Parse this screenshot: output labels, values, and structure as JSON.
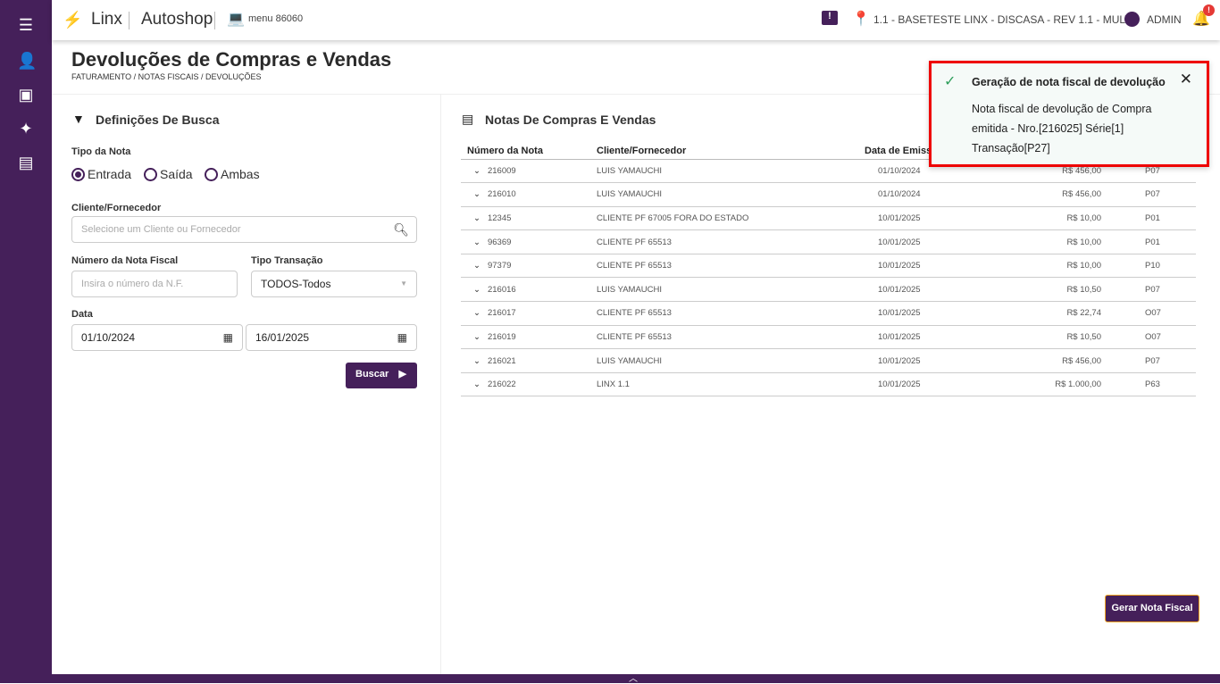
{
  "header": {
    "brand": "Linx",
    "product": "Autoshop",
    "menu": "menu 86060",
    "company": "1.1 - BASETESTE LINX - DISCASA - REV 1.1 - MULT",
    "user": "ADMIN",
    "notification_badge": "!"
  },
  "page": {
    "title": "Devoluções de Compras e Vendas",
    "breadcrumb": "FATURAMENTO / NOTAS FISCAIS / DEVOLUÇÕES"
  },
  "search": {
    "title": "Definições De Busca",
    "tipo_label": "Tipo da Nota",
    "options": [
      "Entrada",
      "Saída",
      "Ambas"
    ],
    "selected": "Entrada",
    "cliente_label": "Cliente/Fornecedor",
    "cliente_placeholder": "Selecione um Cliente ou Fornecedor",
    "nf_label": "Número da Nota Fiscal",
    "nf_placeholder": "Insira o número da N.F.",
    "transacao_label": "Tipo Transação",
    "transacao_value": "TODOS-Todos",
    "data_label": "Data",
    "data_inicio": "01/10/2024",
    "data_fim": "16/01/2025",
    "buscar": "Buscar"
  },
  "notes": {
    "title": "Notas De Compras E Vendas",
    "columns": [
      "Número da Nota",
      "Cliente/Fornecedor",
      "Data de Emissão"
    ],
    "rows": [
      [
        "216009",
        "LUIS YAMAUCHI",
        "01/10/2024",
        "R$ 456,00",
        "P07"
      ],
      [
        "216010",
        "LUIS YAMAUCHI",
        "01/10/2024",
        "R$ 456,00",
        "P07"
      ],
      [
        "12345",
        "CLIENTE PF 67005 FORA DO ESTADO",
        "10/01/2025",
        "R$ 10,00",
        "P01"
      ],
      [
        "96369",
        "CLIENTE PF 65513",
        "10/01/2025",
        "R$ 10,00",
        "P01"
      ],
      [
        "97379",
        "CLIENTE PF 65513",
        "10/01/2025",
        "R$ 10,00",
        "P10"
      ],
      [
        "216016",
        "LUIS YAMAUCHI",
        "10/01/2025",
        "R$ 10,50",
        "P07"
      ],
      [
        "216017",
        "CLIENTE PF 65513",
        "10/01/2025",
        "R$ 22,74",
        "O07"
      ],
      [
        "216019",
        "CLIENTE PF 65513",
        "10/01/2025",
        "R$ 10,50",
        "O07"
      ],
      [
        "216021",
        "LUIS YAMAUCHI",
        "10/01/2025",
        "R$ 456,00",
        "P07"
      ],
      [
        "216022",
        "LINX 1.1",
        "10/01/2025",
        "R$ 1.000,00",
        "P63"
      ]
    ],
    "gerar": "Gerar Nota Fiscal"
  },
  "toast": {
    "title": "Geração de nota fiscal de devolução",
    "message": "Nota fiscal de devolução de Compra emitida - Nro.[216025] Série[1] Transação[P27]"
  }
}
